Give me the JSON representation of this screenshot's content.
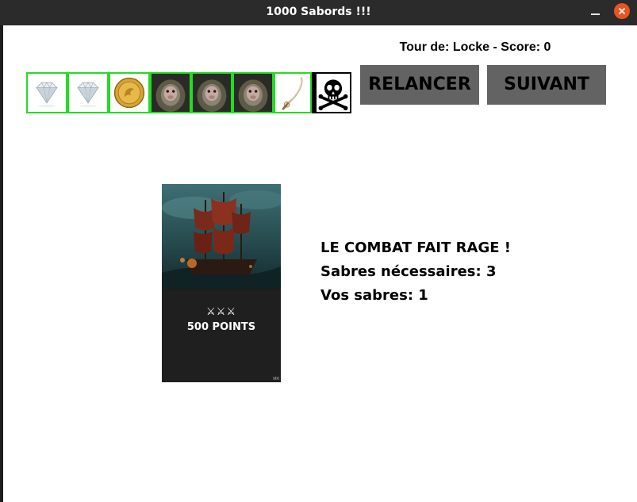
{
  "window": {
    "title": "1000 Sabords !!!",
    "close_icon": "close-icon",
    "minimize_icon": "minimize-icon"
  },
  "game": {
    "turn_text": "Tour de: Locke - Score: 0",
    "dice": [
      {
        "face": "diamond",
        "icon": "diamond-icon"
      },
      {
        "face": "diamond",
        "icon": "diamond-icon"
      },
      {
        "face": "gold-coin",
        "icon": "gold-coin-icon"
      },
      {
        "face": "monkey",
        "icon": "monkey-icon"
      },
      {
        "face": "monkey",
        "icon": "monkey-icon"
      },
      {
        "face": "monkey",
        "icon": "monkey-icon"
      },
      {
        "face": "sword",
        "icon": "sword-icon"
      },
      {
        "face": "skull",
        "icon": "skull-icon"
      }
    ],
    "buttons": {
      "reroll": "RELANCER",
      "next": "SUIVANT"
    },
    "card": {
      "image": "pirate-ship-icon",
      "swords": "⚔⚔⚔",
      "points": "500 POINTS",
      "mark": "MR"
    },
    "status": {
      "line1": "LE COMBAT FAIT RAGE !",
      "line2": "Sabres nécessaires: 3",
      "line3": "Vos sabres: 1"
    }
  },
  "colors": {
    "titlebar": "#2b2b2b",
    "close_button": "#e95420",
    "button_bg": "#636363",
    "kept_die_border": "#22dd22"
  }
}
